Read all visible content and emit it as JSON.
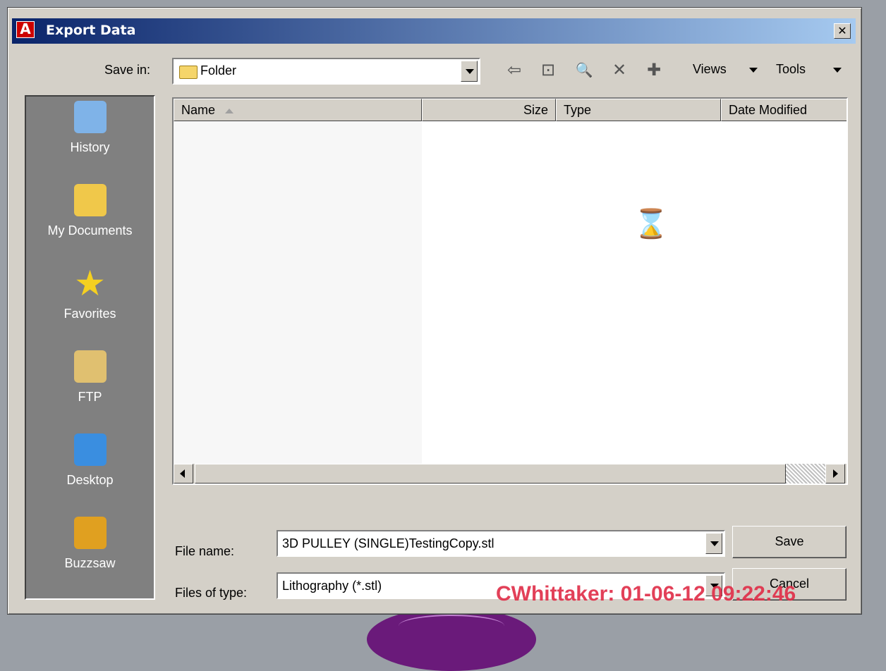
{
  "dialog": {
    "title": "Export Data",
    "app_icon_letter": "A",
    "close_glyph": "✕"
  },
  "toolbar": {
    "save_in_label": "Save in:",
    "save_in_value": "Folder",
    "back_icon": "⇦",
    "up_icon": "⊡",
    "search_icon": "🔍",
    "delete_icon": "✕",
    "new_folder_icon": "✚",
    "views_label": "Views",
    "tools_label": "Tools"
  },
  "places": [
    {
      "label": "History",
      "icon": "history-icon",
      "color": "#7fb3e8"
    },
    {
      "label": "My Documents",
      "icon": "my-documents-icon",
      "color": "#f0c84a"
    },
    {
      "label": "Favorites",
      "icon": "favorites-icon",
      "color": "#f5d020"
    },
    {
      "label": "FTP",
      "icon": "ftp-icon",
      "color": "#e0c070"
    },
    {
      "label": "Desktop",
      "icon": "desktop-icon",
      "color": "#3a8ee0"
    },
    {
      "label": "Buzzsaw",
      "icon": "buzzsaw-icon",
      "color": "#e0a020"
    }
  ],
  "list": {
    "columns": [
      "Name",
      "Size",
      "Type",
      "Date Modified"
    ],
    "busy_cursor": "⌛"
  },
  "form": {
    "file_name_label": "File name:",
    "file_name_value": "3D PULLEY (SINGLE)TestingCopy.stl",
    "file_type_label": "Files of type:",
    "file_type_value": "Lithography (*.stl)"
  },
  "buttons": {
    "save": "Save",
    "cancel": "Cancel"
  },
  "watermark": "CWhittaker: 01-06-12 09:22:46"
}
